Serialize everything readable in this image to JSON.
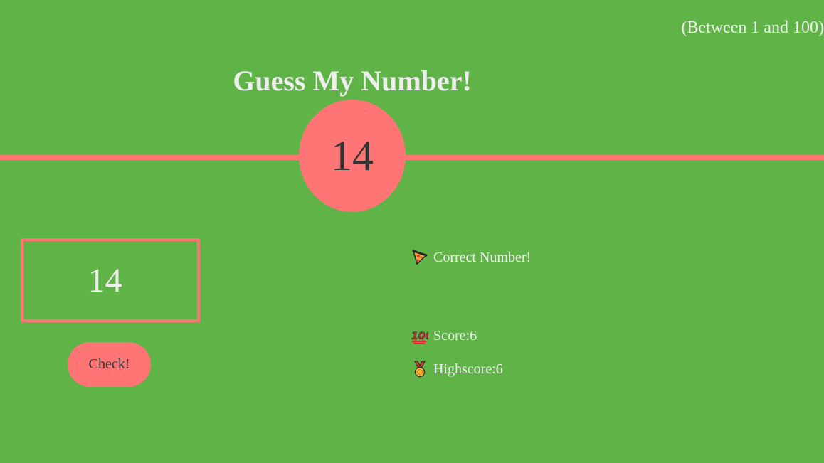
{
  "header": {
    "range_hint": "(Between 1 and 100)",
    "title": "Guess My Number!"
  },
  "secret": {
    "number": "14"
  },
  "guess": {
    "value": "14"
  },
  "controls": {
    "check_label": "Check!"
  },
  "status": {
    "message_icon": "pizza-icon",
    "message": "Correct Number!",
    "score_icon": "hundred-points-icon",
    "score_label": "Score: ",
    "score_value": "6",
    "highscore_icon": "medal-icon",
    "highscore_label": "Highscore: ",
    "highscore_value": "6"
  },
  "colors": {
    "background": "#60b347",
    "accent": "#ff7575",
    "text_light": "#eeeeee",
    "text_dark": "#333333"
  }
}
